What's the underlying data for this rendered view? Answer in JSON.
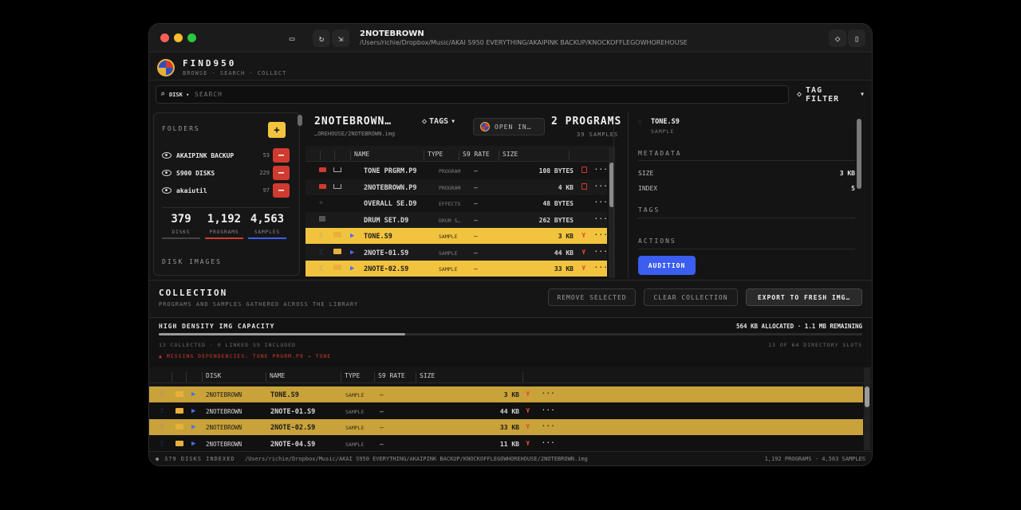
{
  "window": {
    "title": "2NOTEBROWN",
    "path": "/Users/richie/Dropbox/Music/AKAI S950 EVERYTHING/AKAIPINK BACKUP/KNOCKOFFLEGOWHOREHOUSE"
  },
  "app": {
    "name": "FIND950",
    "tagline": "BROWSE · SEARCH · COLLECT"
  },
  "search": {
    "scope": "DISK",
    "placeholder": "SEARCH",
    "tag_filter_label": "TAG FILTER"
  },
  "folders": {
    "title": "FOLDERS",
    "add_label": "+",
    "items": [
      {
        "name": "AKAIPINK BACKUP",
        "count": "53"
      },
      {
        "name": "S900 DISKS",
        "count": "229"
      },
      {
        "name": "akaiutil",
        "count": "97"
      }
    ],
    "remove_label": "−",
    "stats": [
      {
        "value": "379",
        "label": "DISKS"
      },
      {
        "value": "1,192",
        "label": "PROGRAMS"
      },
      {
        "value": "4,563",
        "label": "SAMPLES"
      }
    ],
    "stat_colors": [
      "#444444",
      "#d13b2f",
      "#3b5ef0"
    ],
    "disk_images_title": "DISK IMAGES"
  },
  "disk": {
    "title": "2NOTEBROWN…",
    "path": "…OREHOUSE/2NOTEBROWN.img",
    "tags_label": "TAGS",
    "open_label": "OPEN IN…",
    "programs_count": "2 PROGRAMS",
    "samples_count": "39 SAMPLES",
    "columns": [
      "NAME",
      "TYPE",
      "S9 RATE",
      "SIZE"
    ],
    "rows": [
      {
        "name": "TONE PRGRM.P9",
        "type": "PROGRAM",
        "rate": "—",
        "size": "108 BYTES",
        "kind": "program",
        "hl": false
      },
      {
        "name": "2NOTEBROWN.P9",
        "type": "PROGRAM",
        "rate": "—",
        "size": "4 KB",
        "kind": "program",
        "hl": false
      },
      {
        "name": "OVERALL SE.D9",
        "type": "EFFECTS",
        "rate": "—",
        "size": "48 BYTES",
        "kind": "effects",
        "hl": false
      },
      {
        "name": "DRUM SET.D9",
        "type": "DRUM S…",
        "rate": "—",
        "size": "262 BYTES",
        "kind": "drum",
        "hl": false
      },
      {
        "name": "TONE.S9",
        "type": "SAMPLE",
        "rate": "—",
        "size": "3 KB",
        "kind": "sample",
        "hl": true
      },
      {
        "name": "2NOTE-01.S9",
        "type": "SAMPLE",
        "rate": "—",
        "size": "44 KB",
        "kind": "sample",
        "hl": false
      },
      {
        "name": "2NOTE-02.S9",
        "type": "SAMPLE",
        "rate": "—",
        "size": "33 KB",
        "kind": "sample",
        "hl": true
      }
    ],
    "more_label": "···"
  },
  "inspector": {
    "title": "TONE.S9",
    "subtitle": "SAMPLE",
    "metadata_title": "METADATA",
    "metadata": [
      {
        "key": "SIZE",
        "value": "3 KB"
      },
      {
        "key": "INDEX",
        "value": "5"
      }
    ],
    "tags_title": "TAGS",
    "actions_title": "ACTIONS",
    "audition_label": "AUDITION"
  },
  "collection": {
    "title": "COLLECTION",
    "subtitle": "PROGRAMS AND SAMPLES GATHERED ACROSS THE LIBRARY",
    "remove_selected": "REMOVE SELECTED",
    "clear": "CLEAR COLLECTION",
    "export": "EXPORT TO FRESH IMG…",
    "capacity_title": "HIGH DENSITY IMG CAPACITY",
    "capacity_summary": "564 KB ALLOCATED · 1.1 MB REMAINING",
    "capacity_fraction": 0.35,
    "collected_info": "13 COLLECTED · 0 LINKED S9 INCLUDED",
    "slots_info": "13 OF 64 DIRECTORY SLOTS",
    "warning": "MISSING DEPENDENCIES: TONE PRGRM.P9 → TONE",
    "columns": [
      "DISK",
      "NAME",
      "TYPE",
      "S9 RATE",
      "SIZE"
    ],
    "rows": [
      {
        "disk": "2NOTEBROWN",
        "name": "TONE.S9",
        "type": "SAMPLE",
        "rate": "—",
        "size": "3 KB",
        "hl": true
      },
      {
        "disk": "2NOTEBROWN",
        "name": "2NOTE-01.S9",
        "type": "SAMPLE",
        "rate": "—",
        "size": "44 KB",
        "hl": false
      },
      {
        "disk": "2NOTEBROWN",
        "name": "2NOTE-02.S9",
        "type": "SAMPLE",
        "rate": "—",
        "size": "33 KB",
        "hl": true
      },
      {
        "disk": "2NOTEBROWN",
        "name": "2NOTE-04.S9",
        "type": "SAMPLE",
        "rate": "—",
        "size": "11 KB",
        "hl": false
      }
    ]
  },
  "status": {
    "indexed": "379 DISKS INDEXED",
    "path": "/Users/richie/Dropbox/Music/AKAI S950 EVERYTHING/AKAIPINK BACKUP/KNOCKOFFLEGOWHOREHOUSE/2NOTEBROWN.img",
    "totals": "1,192 PROGRAMS · 4,563 SAMPLES"
  },
  "colors": {
    "accent_yellow": "#f2c33f",
    "accent_red": "#d13b2f",
    "accent_blue": "#3b5ef0",
    "collection_highlight": "#c9a23a"
  }
}
